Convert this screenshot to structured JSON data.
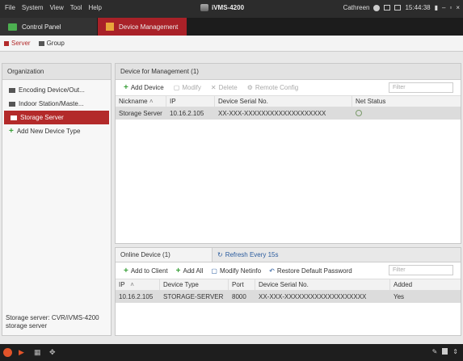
{
  "menu": [
    "File",
    "System",
    "View",
    "Tool",
    "Help"
  ],
  "app_title": "iVMS-4200",
  "user": "Cathreen",
  "clock": "15:44:38",
  "tabs": [
    {
      "label": "Control Panel"
    },
    {
      "label": "Device Management"
    }
  ],
  "subtabs": [
    {
      "label": "Server"
    },
    {
      "label": "Group"
    }
  ],
  "organization": {
    "header": "Organization",
    "items": [
      {
        "label": "Encoding Device/Out..."
      },
      {
        "label": "Indoor Station/Maste..."
      },
      {
        "label": "Storage Server"
      },
      {
        "label": "Add New Device Type"
      }
    ],
    "description": "Storage server: CVR/iVMS-4200 storage server"
  },
  "device_mgmt": {
    "header": "Device for Management (1)",
    "toolbar": {
      "add": "Add Device",
      "modify": "Modify",
      "delete": "Delete",
      "remote": "Remote Config",
      "filter_placeholder": "Filter"
    },
    "columns": [
      "Nickname",
      "IP",
      "Device Serial No.",
      "Net Status"
    ],
    "rows": [
      {
        "nickname": "Storage Server",
        "ip": "10.16.2.105",
        "serial": "XX-XXX-XXXXXXXXXXXXXXXXXXX",
        "status_icon": "network-ok-icon"
      }
    ]
  },
  "online": {
    "tab": "Online Device (1)",
    "refresh": "Refresh Every 15s",
    "toolbar": {
      "add_client": "Add to Client",
      "add_all": "Add All",
      "modify_netinfo": "Modify Netinfo",
      "restore": "Restore Default Password",
      "filter_placeholder": "Filter"
    },
    "columns": [
      "IP",
      "Device Type",
      "Port",
      "Device Serial No.",
      "Added"
    ],
    "rows": [
      {
        "ip": "10.16.2.105",
        "type": "STORAGE-SERVER",
        "port": "8000",
        "serial": "XX-XXX-XXXXXXXXXXXXXXXXXXX",
        "added": "Yes"
      }
    ]
  },
  "colors": {
    "accent_red": "#a92128",
    "add_green": "#3aa03a"
  }
}
